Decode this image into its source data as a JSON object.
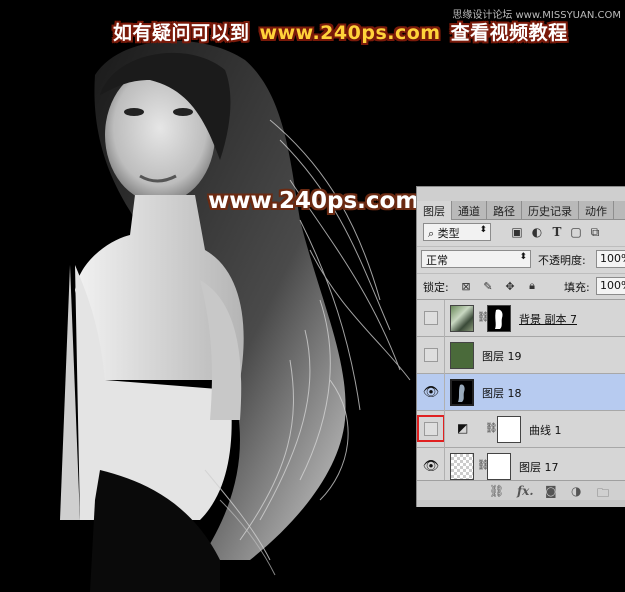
{
  "watermarks": {
    "top_left": "如有疑问可以到",
    "top_url": "www.240ps.com",
    "top_right": "查看视频教程",
    "corner": "思缘设计论坛 www.MISSYUAN.COM",
    "center": "www.240ps.com"
  },
  "layers_panel": {
    "tabs": [
      "图层",
      "通道",
      "路径",
      "历史记录",
      "动作"
    ],
    "active_tab": "图层",
    "filter": {
      "label": "类型",
      "icons": [
        "image-filter-icon",
        "adjustment-filter-icon",
        "type-filter-icon",
        "shape-filter-icon",
        "smart-object-filter-icon"
      ]
    },
    "blend_mode": "正常",
    "opacity_label": "不透明度:",
    "opacity_value": "100%",
    "lock_label": "锁定:",
    "fill_label": "填充:",
    "fill_value": "100%",
    "layers": [
      {
        "name": "背景 副本 7",
        "visible": false,
        "type": "photo-with-mask"
      },
      {
        "name": "图层 19",
        "visible": false,
        "type": "solid-green"
      },
      {
        "name": "图层 18",
        "visible": true,
        "selected": true,
        "type": "dark-with-mask"
      },
      {
        "name": "曲线 1",
        "visible": false,
        "highlighted": true,
        "type": "curves-adjustment"
      },
      {
        "name": "图层 17",
        "visible": true,
        "type": "transparent-with-mask"
      }
    ],
    "footer_icons": [
      "link-layers-icon",
      "fx-icon",
      "add-mask-icon",
      "adjustment-layer-icon",
      "new-group-icon"
    ],
    "fx_label": "fx.",
    "colors": {
      "selected_row": "#b7cbf0",
      "highlight_box": "#e02020",
      "green_fill": "#4a6a3a"
    }
  }
}
